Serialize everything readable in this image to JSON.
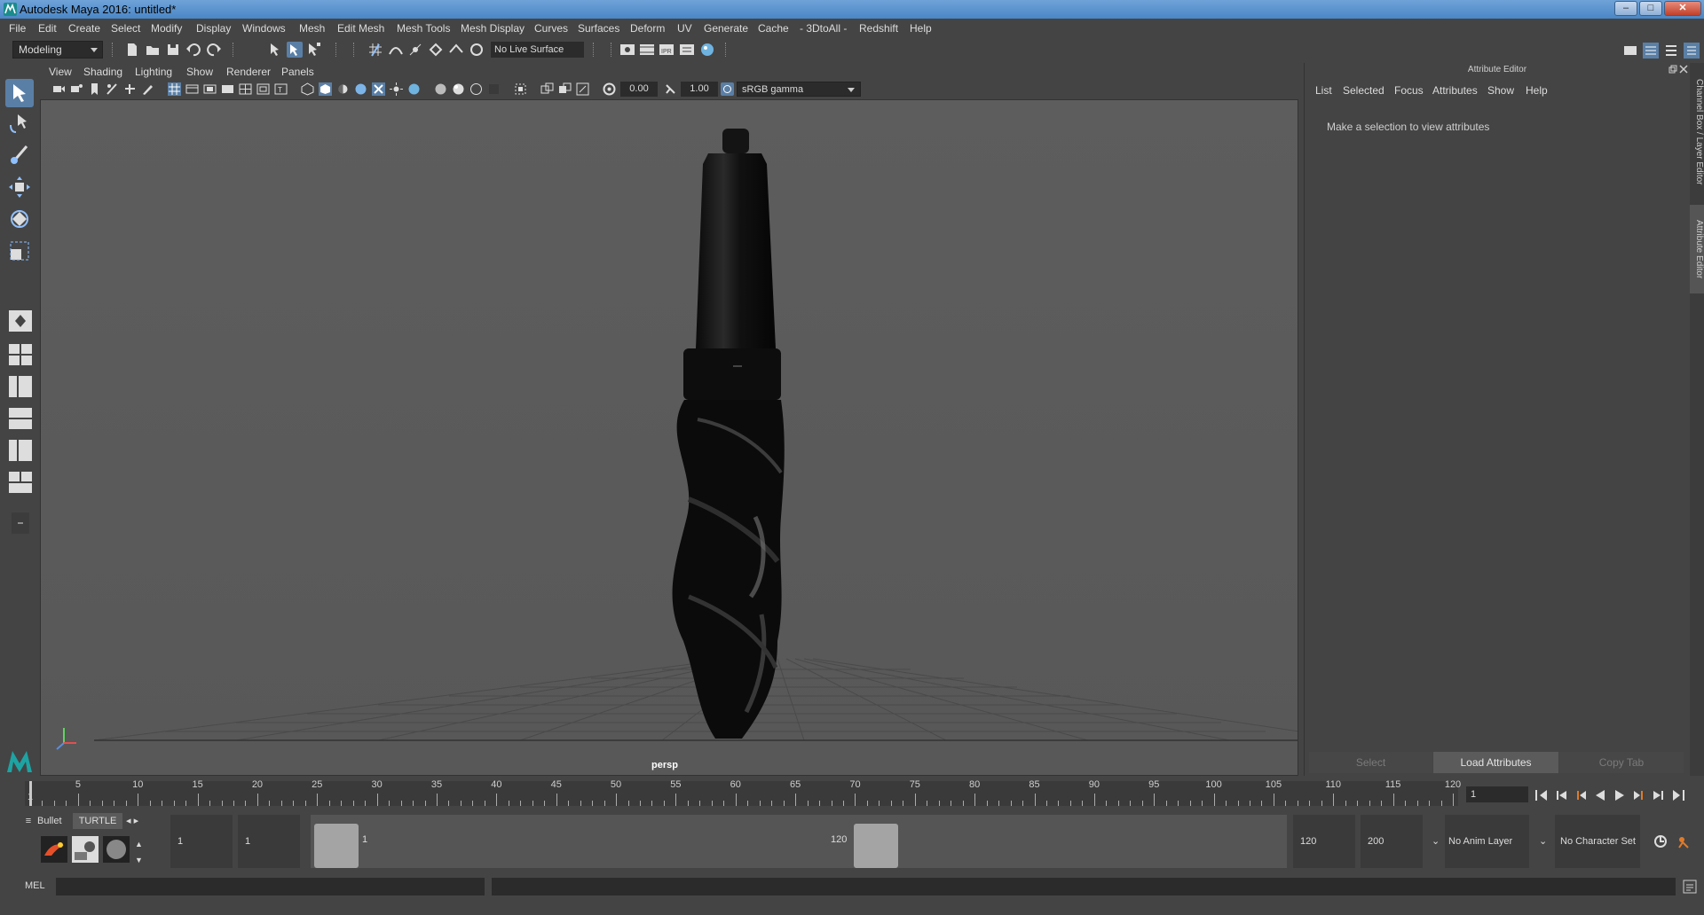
{
  "window": {
    "title": "Autodesk Maya 2016: untitled*",
    "controls": {
      "minimize": "–",
      "maximize": "□",
      "close": "✕"
    }
  },
  "menubar": [
    "File",
    "Edit",
    "Create",
    "Select",
    "Modify",
    "Display",
    "Windows",
    "Mesh",
    "Edit Mesh",
    "Mesh Tools",
    "Mesh Display",
    "Curves",
    "Surfaces",
    "Deform",
    "UV",
    "Generate",
    "Cache",
    "- 3DtoAll -",
    "Redshift",
    "Help"
  ],
  "statusline": {
    "mode": "Modeling",
    "live_surface": "No Live Surface"
  },
  "panel": {
    "menus": [
      "View",
      "Shading",
      "Lighting",
      "Show",
      "Renderer",
      "Panels"
    ],
    "exposure": "0.00",
    "gamma": "1.00",
    "color_space": "sRGB gamma",
    "camera": "persp"
  },
  "attribute_editor": {
    "title": "Attribute Editor",
    "menus": [
      "List",
      "Selected",
      "Focus",
      "Attributes",
      "Show",
      "Help"
    ],
    "message": "Make a selection to view attributes",
    "buttons": {
      "select": "Select",
      "load": "Load Attributes",
      "copy": "Copy Tab"
    }
  },
  "side_tabs": {
    "channel_box": "Channel Box / Layer Editor",
    "attribute_editor": "Attribute Editor"
  },
  "timeline": {
    "ticks": [
      "1",
      "5",
      "10",
      "15",
      "20",
      "25",
      "30",
      "35",
      "40",
      "45",
      "50",
      "55",
      "60",
      "65",
      "70",
      "75",
      "80",
      "85",
      "90",
      "95",
      "100",
      "105",
      "110",
      "115",
      "120"
    ],
    "current_frame": "1"
  },
  "range": {
    "start": "1",
    "playback_start": "1",
    "slider_start": "1",
    "slider_end": "120",
    "playback_end": "120",
    "end": "200",
    "anim_layer": "No Anim Layer",
    "character_set": "No Character Set"
  },
  "shelf": {
    "tabs": [
      "Bullet",
      "TURTLE"
    ]
  },
  "cmdline": {
    "lang": "MEL"
  },
  "colors": {
    "accent": "#5a7fa6",
    "background": "#444444",
    "viewport": "#5a5a5a"
  }
}
